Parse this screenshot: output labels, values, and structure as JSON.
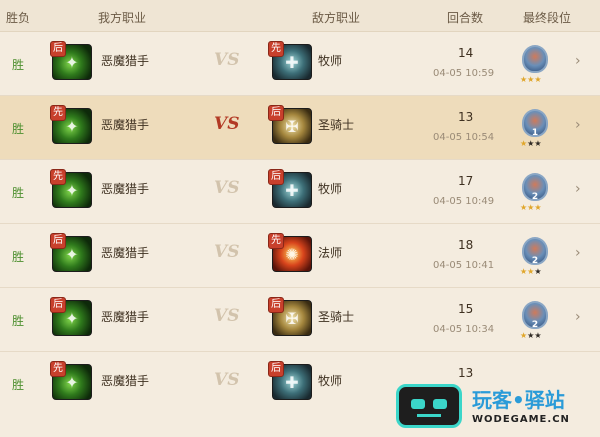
{
  "header": {
    "result": "胜负",
    "my_class": "我方职业",
    "enemy_class": "敌方职业",
    "turns": "回合数",
    "final_rank": "最终段位"
  },
  "matches": [
    {
      "result": "胜",
      "my_order": "后",
      "my_class": "恶魔猎手",
      "vs": "VS",
      "enemy_order": "先",
      "enemy_class": "牧师",
      "turns": "14",
      "time": "04-05 10:59",
      "rank": "",
      "stars": [
        true,
        true,
        true
      ],
      "highlighted": false
    },
    {
      "result": "胜",
      "my_order": "先",
      "my_class": "恶魔猎手",
      "vs": "VS",
      "enemy_order": "后",
      "enemy_class": "圣骑士",
      "turns": "13",
      "time": "04-05 10:54",
      "rank": "1",
      "stars": [
        true,
        false,
        false
      ],
      "highlighted": true
    },
    {
      "result": "胜",
      "my_order": "先",
      "my_class": "恶魔猎手",
      "vs": "VS",
      "enemy_order": "后",
      "enemy_class": "牧师",
      "turns": "17",
      "time": "04-05 10:49",
      "rank": "2",
      "stars": [
        true,
        true,
        true
      ],
      "highlighted": false
    },
    {
      "result": "胜",
      "my_order": "后",
      "my_class": "恶魔猎手",
      "vs": "VS",
      "enemy_order": "先",
      "enemy_class": "法师",
      "turns": "18",
      "time": "04-05 10:41",
      "rank": "2",
      "stars": [
        true,
        true,
        false
      ],
      "highlighted": false
    },
    {
      "result": "胜",
      "my_order": "后",
      "my_class": "恶魔猎手",
      "vs": "VS",
      "enemy_order": "后",
      "enemy_class": "圣骑士",
      "turns": "15",
      "time": "04-05 10:34",
      "rank": "2",
      "stars": [
        true,
        false,
        false
      ],
      "highlighted": false
    },
    {
      "result": "胜",
      "my_order": "先",
      "my_class": "恶魔猎手",
      "vs": "VS",
      "enemy_order": "后",
      "enemy_class": "牧师",
      "turns": "13",
      "time": "",
      "rank": "",
      "stars": [],
      "highlighted": false
    }
  ],
  "watermark": {
    "name": "玩客•驿站",
    "url": "WODEGAME.CN"
  },
  "colors": {
    "win": "#4d8f2f",
    "badge": "#c8402c",
    "highlight_row": "#eedcbb",
    "vs_active": "#b23a25"
  }
}
